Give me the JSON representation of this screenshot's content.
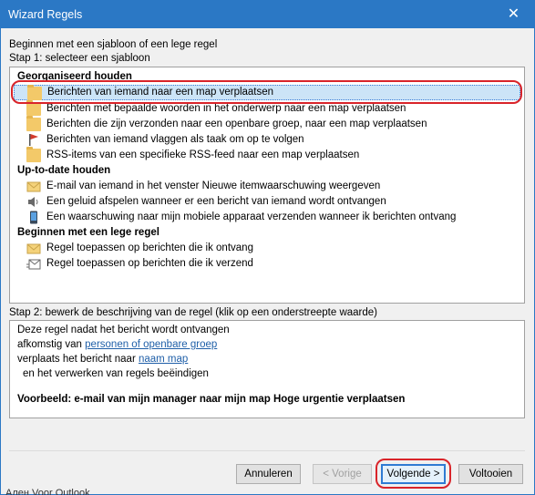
{
  "window": {
    "title": "Wizard Regels",
    "close_glyph": "✕"
  },
  "intro": "Beginnen met een sjabloon of een lege regel",
  "step1_label": "Stap 1: selecteer een sjabloon",
  "groups": {
    "organized": "Georganiseerd houden",
    "uptodate": "Up-to-date houden",
    "blank": "Beginnen met een lege regel"
  },
  "templates": [
    {
      "label": "Berichten van iemand naar een map verplaatsen",
      "icon": "folder-icon",
      "selected": true
    },
    {
      "label": "Berichten met bepaalde woorden in het onderwerp naar een map verplaatsen",
      "icon": "folder-icon"
    },
    {
      "label": "Berichten die zijn verzonden naar een openbare groep, naar een map verplaatsen",
      "icon": "folder-icon"
    },
    {
      "label": "Berichten van iemand vlaggen als taak om op te volgen",
      "icon": "flag-icon"
    },
    {
      "label": "RSS-items van een specifieke RSS-feed naar een map verplaatsen",
      "icon": "folder-icon"
    },
    {
      "label": "E-mail van iemand in het venster Nieuwe itemwaarschuwing weergeven",
      "icon": "envelope-icon"
    },
    {
      "label": "Een geluid afspelen wanneer er een bericht van iemand wordt ontvangen",
      "icon": "speaker-icon"
    },
    {
      "label": "Een waarschuwing naar mijn mobiele apparaat verzenden wanneer ik berichten ontvang",
      "icon": "phone-icon"
    },
    {
      "label": "Regel toepassen op berichten die ik ontvang",
      "icon": "envelope-icon"
    },
    {
      "label": "Regel toepassen op berichten die ik verzend",
      "icon": "send-icon"
    }
  ],
  "step2_label": "Stap 2: bewerk de beschrijving van de regel (klik op een onderstreepte waarde)",
  "description": {
    "line1": "Deze regel nadat het bericht wordt ontvangen",
    "line2_prefix": "afkomstig van ",
    "line2_link": "personen of openbare groep",
    "line3_prefix": "verplaats het bericht naar ",
    "line3_link": "naam map",
    "line4": "en het verwerken van regels beëindigen",
    "example": "Voorbeeld: e-mail van mijn manager naar mijn map Hoge urgentie verplaatsen"
  },
  "buttons": {
    "cancel": "Annuleren",
    "back": "< Vorige",
    "next": "Volgende >",
    "finish": "Voltooien"
  },
  "footer_clip": "Ален Voor Outlook"
}
